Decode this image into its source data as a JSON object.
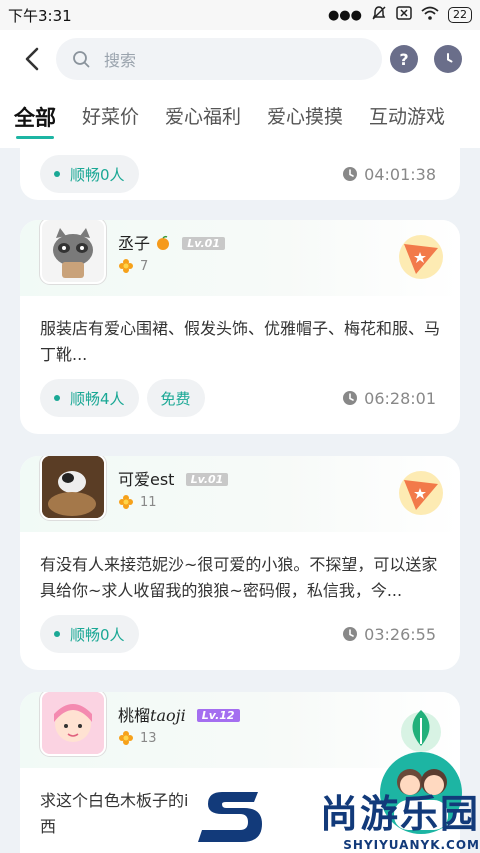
{
  "status_bar": {
    "time": "下午3:31",
    "battery": "22"
  },
  "search": {
    "placeholder": "搜索"
  },
  "header_buttons": {
    "help": "?"
  },
  "tabs": [
    "全部",
    "好菜价",
    "爱心福利",
    "爱心摸摸",
    "互动游戏"
  ],
  "posts": [
    {
      "status": "顺畅0人",
      "time": "04:01:38"
    },
    {
      "username": "丞子",
      "level": "Lv.01",
      "flowers": "7",
      "content": "服装店有爱心围裙、假发头饰、优雅帽子、梅花和服、马丁靴...",
      "status": "顺畅4人",
      "tag": "免费",
      "time": "06:28:01"
    },
    {
      "username": "可爱est",
      "level": "Lv.01",
      "flowers": "11",
      "content": "有没有人来接范妮沙~很可爱的小狼。不探望，可以送家具给你~求人收留我的狼狼~密码假，私信我，今...",
      "status": "顺畅0人",
      "time": "03:26:55"
    },
    {
      "username": "桃榴",
      "username_script": "taoji",
      "level": "Lv.12",
      "flowers": "13",
      "content": "求这个白色木板子的i\n西"
    }
  ],
  "watermark": {
    "name": "尚游乐园",
    "url": "SHYIYUANYK.COM"
  },
  "colors": {
    "accent": "#1db5a3",
    "level_purple": "#a46ef0",
    "header_icon": "#6a6e8a"
  }
}
